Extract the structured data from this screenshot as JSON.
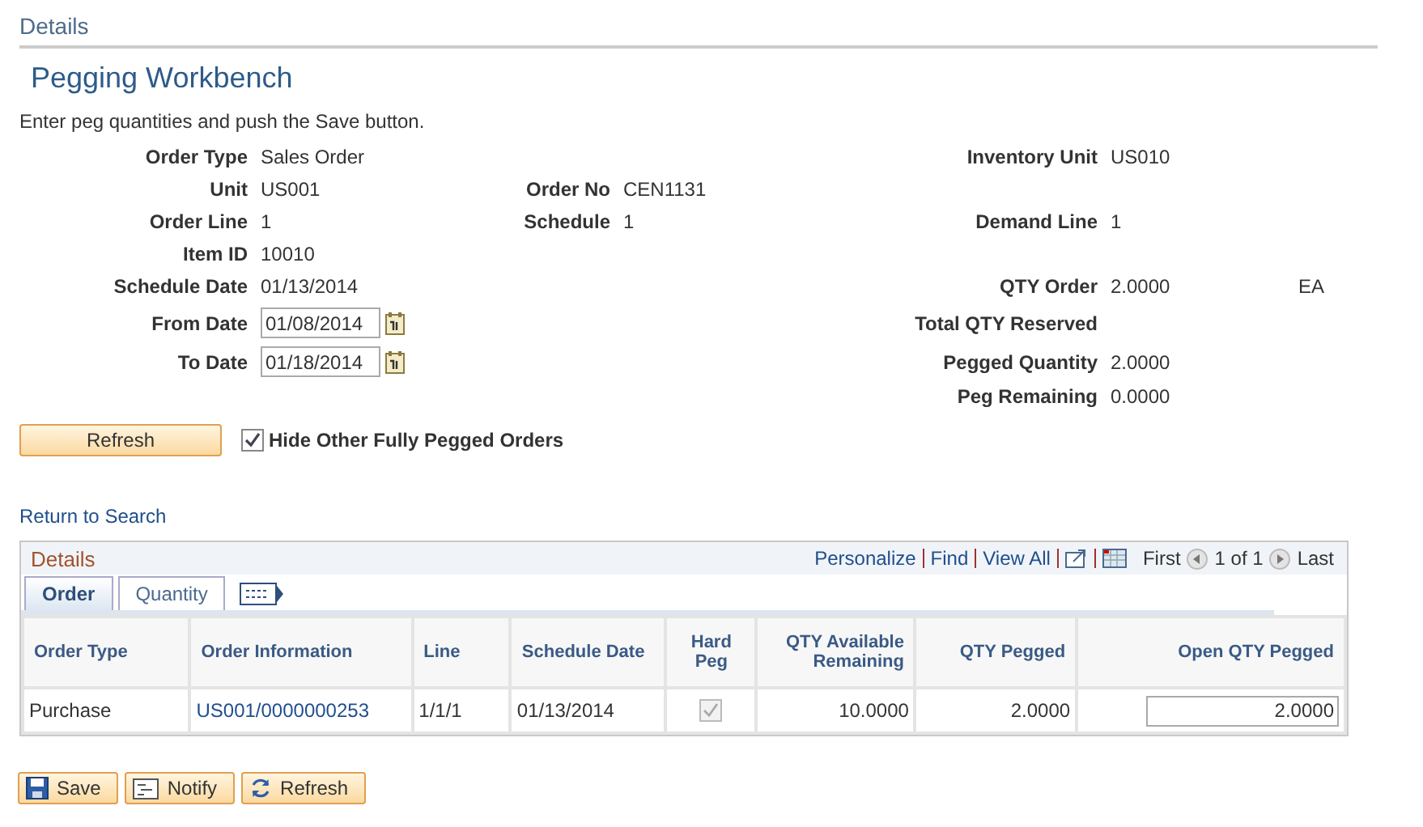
{
  "page_header": "Details",
  "title": "Pegging Workbench",
  "instructions": "Enter peg quantities and push the Save button.",
  "form_rows": [
    {
      "left": {
        "label": "Order Type",
        "value": "Sales Order",
        "kind": "text"
      },
      "right": {
        "label": "Inventory Unit",
        "value": "US010",
        "kind": "text"
      }
    },
    {
      "left": {
        "label": "Unit",
        "value": "US001",
        "kind": "text"
      },
      "middle": {
        "label": "Order No",
        "value": "CEN1131",
        "kind": "text"
      }
    },
    {
      "left": {
        "label": "Order Line",
        "value": "1",
        "kind": "text"
      },
      "middle": {
        "label": "Schedule",
        "value": "1",
        "kind": "text"
      },
      "right": {
        "label": "Demand Line",
        "value": "1",
        "kind": "text"
      }
    },
    {
      "left": {
        "label": "Item ID",
        "value": "10010",
        "kind": "text"
      }
    },
    {
      "left": {
        "label": "Schedule Date",
        "value": "01/13/2014",
        "kind": "text"
      },
      "right": {
        "label": "QTY Order",
        "value": "2.0000",
        "kind": "text",
        "unit": "EA"
      }
    },
    {
      "left": {
        "label": "From Date",
        "value": "01/08/2014",
        "kind": "date"
      },
      "right": {
        "label": "Total QTY Reserved",
        "kind": "text"
      }
    },
    {
      "left": {
        "label": "To Date",
        "value": "01/18/2014",
        "kind": "date"
      },
      "right": {
        "label": "Pegged Quantity",
        "value": "2.0000",
        "kind": "text"
      }
    },
    {
      "right": {
        "label": "Peg Remaining",
        "value": "0.0000",
        "kind": "text"
      }
    }
  ],
  "refresh_button": "Refresh",
  "hide_pegged": {
    "label": "Hide Other Fully Pegged Orders",
    "checked": true
  },
  "return_link": "Return to Search",
  "grid": {
    "title": "Details",
    "nav_links": [
      "Personalize",
      "Find",
      "View All"
    ],
    "pager": {
      "first": "First",
      "range": "1 of 1",
      "last": "Last"
    },
    "tabs": [
      {
        "label": "Order",
        "selected": true
      },
      {
        "label": "Quantity",
        "selected": false
      }
    ],
    "columns": [
      "Order Type",
      "Order Information",
      "Line",
      "Schedule Date",
      "Hard Peg",
      "QTY Available Remaining",
      "QTY Pegged",
      "Open QTY Pegged"
    ],
    "rows": [
      {
        "order_type": "Purchase",
        "order_information": "US001/0000000253",
        "line": "1/1/1",
        "schedule_date": "01/13/2014",
        "hard_peg": true,
        "qty_available_remaining": "10.0000",
        "qty_pegged": "2.0000",
        "open_qty_pegged": "2.0000"
      }
    ]
  },
  "actions": [
    {
      "label": "Save",
      "kind": "save"
    },
    {
      "label": "Notify",
      "kind": "notify"
    },
    {
      "label": "Refresh",
      "kind": "refresh"
    }
  ]
}
